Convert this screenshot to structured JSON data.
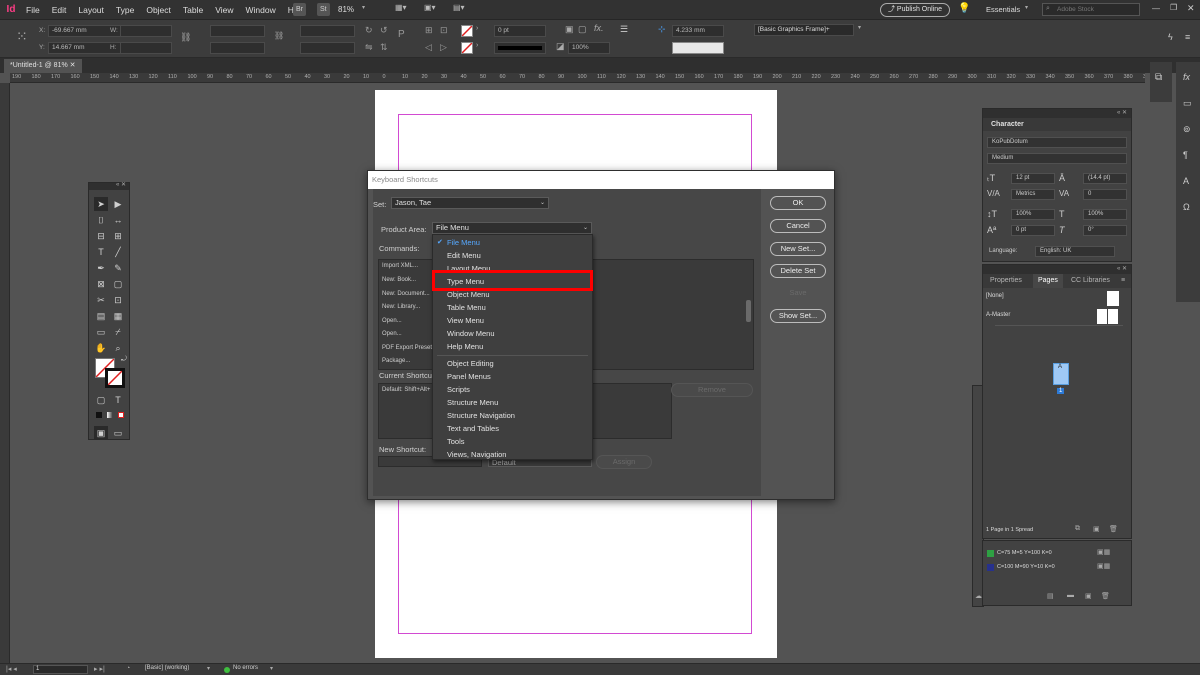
{
  "app": {
    "logo": "Id",
    "menus": [
      "File",
      "Edit",
      "Layout",
      "Type",
      "Object",
      "Table",
      "View",
      "Window",
      "Help"
    ],
    "bridge": "Br",
    "stock": "St",
    "zoom": "81%",
    "publish_label": "Publish Online",
    "workspace": "Essentials",
    "search_placeholder": "Adobe Stock"
  },
  "control_bar": {
    "x_label": "X:",
    "x_value": "-69.667 mm",
    "y_label": "Y:",
    "y_value": "14.667 mm",
    "w_label": "W:",
    "h_label": "H:",
    "stroke_weight": "0 pt",
    "opacity": "100%",
    "gap": "4.233 mm",
    "frame_style": "[Basic Graphics Frame]+"
  },
  "document_tab": "*Untitled-1 @ 81%",
  "ruler_ticks": [
    "190",
    "180",
    "170",
    "160",
    "150",
    "140",
    "130",
    "120",
    "110",
    "100",
    "90",
    "80",
    "70",
    "60",
    "50",
    "40",
    "30",
    "20",
    "10",
    "0",
    "10",
    "20",
    "30",
    "40",
    "50",
    "60",
    "70",
    "80",
    "90",
    "100",
    "110",
    "120",
    "130",
    "140",
    "150",
    "160",
    "170",
    "180",
    "190",
    "200",
    "210",
    "220",
    "230",
    "240",
    "250",
    "260",
    "270",
    "280",
    "290",
    "300",
    "310",
    "320",
    "330",
    "340",
    "350",
    "360",
    "370",
    "380",
    "390"
  ],
  "dialog": {
    "title": "Keyboard Shortcuts",
    "set_label": "Set:",
    "set_value": "Jason, Tae",
    "product_area_label": "Product Area:",
    "product_area_value": "File Menu",
    "commands_label": "Commands:",
    "commands": [
      "Import XML...",
      "New: Book...",
      "New: Document...",
      "New: Library...",
      "Open...",
      "Open...",
      "PDF Export Preset",
      "Package..."
    ],
    "current_shortcuts_label": "Current Shortcu",
    "current_shortcut_value": "Default: Shift+Alt+",
    "new_shortcut_label": "New Shortcut:",
    "context_value": "Default",
    "remove_label": "Remove",
    "assign_label": "Assign",
    "buttons": {
      "ok": "OK",
      "cancel": "Cancel",
      "new_set": "New Set...",
      "delete_set": "Delete Set",
      "save": "Save",
      "show_set": "Show Set..."
    }
  },
  "dropdown": {
    "selected": "File Menu",
    "items": [
      "File Menu",
      "Edit Menu",
      "Layout Menu",
      "Type Menu",
      "Object Menu",
      "Table Menu",
      "View Menu",
      "Window Menu",
      "Help Menu",
      "Object Editing",
      "Panel Menus",
      "Scripts",
      "Structure Menu",
      "Structure Navigation",
      "Text and Tables",
      "Tools",
      "Views, Navigation"
    ],
    "highlighted": "Type Menu"
  },
  "character_panel": {
    "title": "Character",
    "font": "KoPubDotum",
    "style": "Medium",
    "size": "12 pt",
    "leading": "(14.4 pt)",
    "kerning": "Metrics",
    "tracking": "0",
    "vscale": "100%",
    "hscale": "100%",
    "baseline": "0 pt",
    "skew": "0°",
    "language_label": "Language:",
    "language": "English: UK"
  },
  "pages_panel": {
    "tabs": [
      "Properties",
      "Pages",
      "CC Libraries"
    ],
    "none_label": "[None]",
    "master_label": "A-Master",
    "page_letter": "A",
    "page_number": "1",
    "footer": "1 Page in 1 Spread"
  },
  "swatches": [
    {
      "label": "C=75 M=5 Y=100 K=0",
      "color": "#2ea043"
    },
    {
      "label": "C=100 M=90 Y=10 K=0",
      "color": "#27318c"
    }
  ],
  "status_bar": {
    "page": "1",
    "style": "[Basic] (working)",
    "errors": "No errors"
  },
  "colors": {
    "accent_blue": "#56a8ff",
    "highlight_red": "#ff0000",
    "margin_magenta": "#d24ad2",
    "ok_green": "#3fbf3f"
  }
}
